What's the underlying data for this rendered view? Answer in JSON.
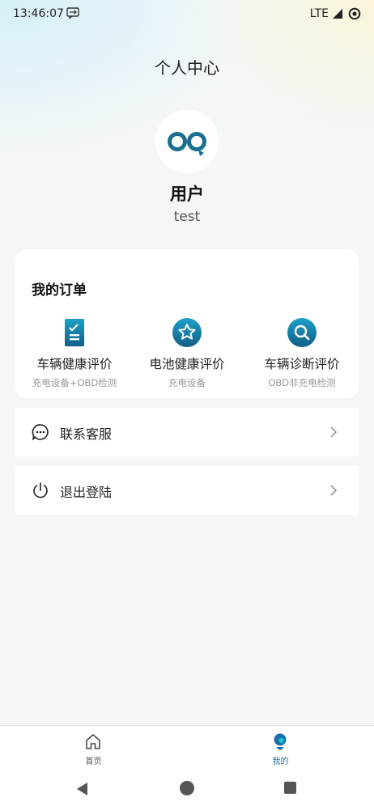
{
  "status_bar": {
    "time": "13:46:07",
    "network": "LTE",
    "icons": [
      "message-icon",
      "signal-icon",
      "battery-icon"
    ]
  },
  "header": {
    "title": "个人中心"
  },
  "profile": {
    "name": "用户",
    "username": "test",
    "avatar_icon": "infinity-logo-icon"
  },
  "orders": {
    "title": "我的订单",
    "items": [
      {
        "label": "车辆健康评价",
        "description": "充电设备+OBD检测",
        "icon": "checklist-icon"
      },
      {
        "label": "电池健康评价",
        "description": "充电设备",
        "icon": "star-badge-icon"
      },
      {
        "label": "车辆诊断评价",
        "description": "OBD非充电检测",
        "icon": "search-badge-icon"
      }
    ]
  },
  "menu": {
    "items": [
      {
        "label": "联系客服",
        "icon": "chat-icon"
      },
      {
        "label": "退出登陆",
        "icon": "power-icon"
      }
    ]
  },
  "bottom_nav": {
    "tabs": [
      {
        "label": "首页",
        "icon": "home-icon",
        "active": false
      },
      {
        "label": "我的",
        "icon": "profile-icon",
        "active": true
      }
    ]
  },
  "colors": {
    "accent": "#1a6e8f",
    "active_tab": "#1b6ea8",
    "inactive_tab": "#555555",
    "background": "#f6f6f6"
  }
}
